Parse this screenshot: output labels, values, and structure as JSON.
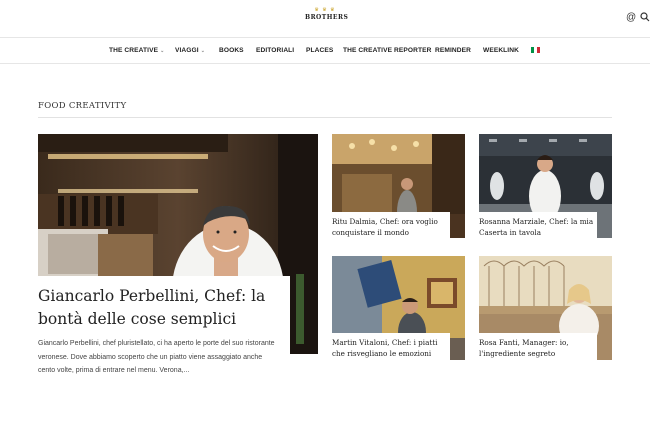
{
  "header": {
    "logo_text": "BROTHERS",
    "logo_crown": "♛ ♛ ♛",
    "at_icon": "@",
    "search_icon": "search-icon"
  },
  "nav": {
    "items": [
      {
        "label": "THE CREATIVE",
        "dropdown": true
      },
      {
        "label": "VIAGGI",
        "dropdown": true
      },
      {
        "label": "BOOKS",
        "dropdown": false
      },
      {
        "label": "EDITORIALI",
        "dropdown": false
      },
      {
        "label": "PLACES",
        "dropdown": false
      },
      {
        "label": "THE CREATIVE REPORTER",
        "dropdown": false
      },
      {
        "label": "REMINDER",
        "dropdown": false
      },
      {
        "label": "WEEKLINK",
        "dropdown": false
      }
    ],
    "chevron": "⌄",
    "flag_colors": [
      "#009246",
      "#ffffff",
      "#ce2b37"
    ]
  },
  "section": {
    "title": "FOOD CREATIVITY"
  },
  "featured": {
    "title": "Giancarlo Perbellini, Chef: la bontà delle cose semplici",
    "excerpt": "Giancarlo Perbellini, chef pluristellato, ci ha aperto le porte del suo ristorante veronese. Dove abbiamo scoperto che un piatto viene assaggiato anche cento volte, prima di entrare nel menu.     Verona,..."
  },
  "cards": [
    {
      "title": "Ritu Dalmia, Chef: ora voglio conquistare il mondo"
    },
    {
      "title": "Rosanna Marziale, Chef: la mia Caserta in tavola"
    },
    {
      "title": "Martin Vitaloni, Chef: i piatti che risvegliano le emozioni"
    },
    {
      "title": "Rosa Fanti, Manager: io, l'ingrediente segreto"
    }
  ]
}
